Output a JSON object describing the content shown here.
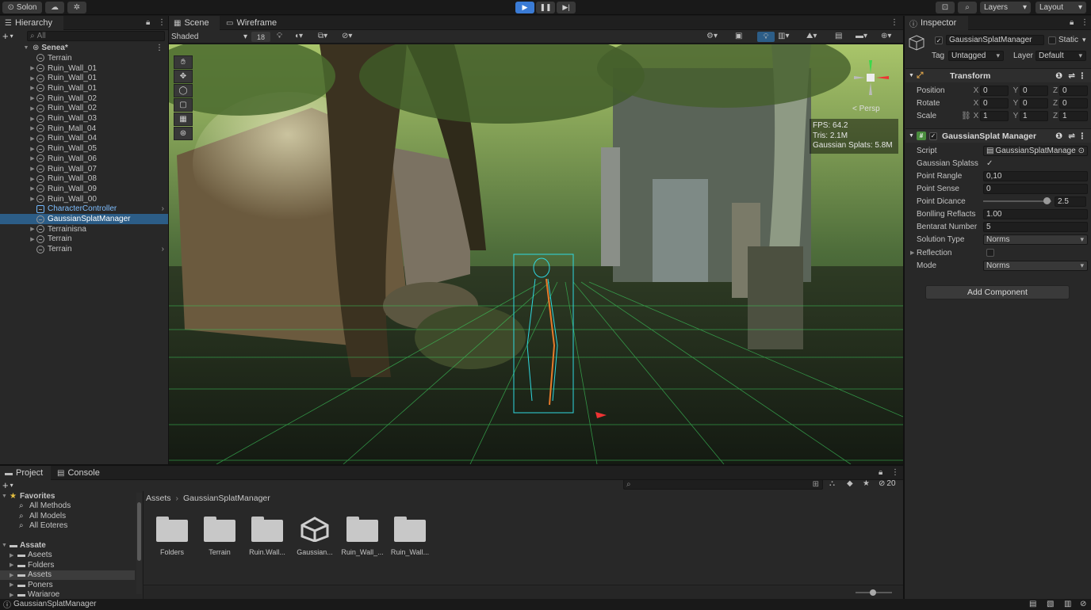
{
  "toolbar": {
    "account_label": "Solon",
    "layers_label": "Layers",
    "layout_label": "Layout"
  },
  "hierarchy": {
    "tab_label": "Hierarchy",
    "search_placeholder": "All",
    "scene_name": "Senea*",
    "items": [
      {
        "label": "Terrain",
        "arrow": ""
      },
      {
        "label": "Ruin_Wall_01",
        "arrow": "▶"
      },
      {
        "label": "Ruin_Wall_01",
        "arrow": "▶"
      },
      {
        "label": "Ruin_Wall_01",
        "arrow": "▶"
      },
      {
        "label": "Ruin_Wall_02",
        "arrow": "▶"
      },
      {
        "label": "Ruin_Wall_02",
        "arrow": "▶"
      },
      {
        "label": "Ruin_Wall_03",
        "arrow": "▶"
      },
      {
        "label": "Ruin_Mall_04",
        "arrow": "▶"
      },
      {
        "label": "Ruin_Wall_04",
        "arrow": "▶"
      },
      {
        "label": "Ruin_Wall_05",
        "arrow": "▶"
      },
      {
        "label": "Ruin_Wall_06",
        "arrow": "▶"
      },
      {
        "label": "Ruin_Wall_07",
        "arrow": "▶"
      },
      {
        "label": "Ruin_Wall_08",
        "arrow": "▶"
      },
      {
        "label": "Ruin_Wall_09",
        "arrow": "▶"
      },
      {
        "label": "Ruin_Wall_00",
        "arrow": "▶"
      },
      {
        "label": "CharacterController",
        "arrow": ""
      },
      {
        "label": "GaussianSplatManager",
        "arrow": ""
      },
      {
        "label": "Terrainisna",
        "arrow": "▶"
      },
      {
        "label": "Terrain",
        "arrow": "▶"
      },
      {
        "label": "Terrain",
        "arrow": ""
      }
    ]
  },
  "scene": {
    "tab_scene": "Scene",
    "tab_wireframe": "Wireframe",
    "shading_mode": "Shaded",
    "grid_size": "18",
    "persp_label": "< Persp",
    "stats": {
      "fps": "FPS: 64.2",
      "tris": "Tris: 2.1M",
      "splats": "Gaussian Splats: 5.8M"
    }
  },
  "inspector": {
    "tab_label": "Inspector",
    "object_name": "GaussianSplatManager",
    "static_label": "Static",
    "tag_label": "Tag",
    "tag_value": "Untagged",
    "layer_label": "Layer",
    "layer_value": "Default",
    "transform": {
      "title": "Transform",
      "position": {
        "label": "Position",
        "x": "0",
        "y": "0",
        "z": "0"
      },
      "rotate": {
        "label": "Rotate",
        "x": "0",
        "y": "0",
        "z": "0"
      },
      "scale": {
        "label": "Scale",
        "x": "1",
        "y": "1",
        "z": "1"
      }
    },
    "splat": {
      "title": "GaussianSplat Manager",
      "script_label": "Script",
      "script_value": "GaussianSplatManage",
      "gaussian_splats_label": "Gaussian Splatss",
      "point_range_label": "Point Rangle",
      "point_range_value": "0,10",
      "point_sense_label": "Point Sense",
      "point_sense_value": "0",
      "point_distance_label": "Point Dicance",
      "point_distance_value": "2.5",
      "point_distance_fraction": 0.94,
      "boiling_label": "Bonlling Reflacts",
      "boiling_value": "1.00",
      "bentarat_label": "Bentarat Number",
      "bentarat_value": "5",
      "solution_label": "Solution Type",
      "solution_value": "Norms",
      "reflection_label": "Reflection",
      "mode_label": "Mode",
      "mode_value": "Norms"
    },
    "add_component": "Add Component"
  },
  "project": {
    "tab_project": "Project",
    "tab_console": "Console",
    "favorites_label": "Favorites",
    "favorites": [
      "All Methods",
      "All Models",
      "All Eoteres"
    ],
    "assets_label": "Assate",
    "asset_tree": [
      "Aseets",
      "Folders",
      "Assets",
      "Poners",
      "Wariaroe"
    ],
    "breadcrumb_root": "Assets",
    "breadcrumb_leaf": "GaussianSplatManager",
    "hidden_count": "20",
    "assets": [
      {
        "label": "Folders",
        "type": "folder"
      },
      {
        "label": "Terrain",
        "type": "folder"
      },
      {
        "label": "Ruin.Wall...",
        "type": "folder"
      },
      {
        "label": "Gaussian...",
        "type": "unity"
      },
      {
        "label": "Ruin_Wall_...",
        "type": "folder"
      },
      {
        "label": "Ruin_Wall...",
        "type": "folder"
      }
    ]
  },
  "statusbar": {
    "text": "GaussianSplatManager"
  }
}
